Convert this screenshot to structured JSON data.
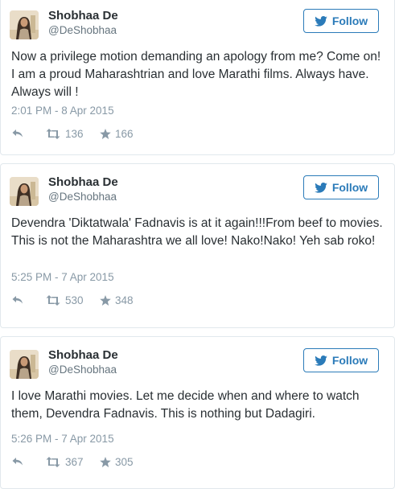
{
  "colors": {
    "follow_accent": "#2b7bb9",
    "meta_gray": "#8899a6",
    "handle_gray": "#66757f",
    "text": "#292f33",
    "border": "#e1e8ed"
  },
  "tweets": [
    {
      "author": {
        "name": "Shobhaa De",
        "handle": "@DeShobhaa"
      },
      "follow_label": "Follow",
      "text": "Now a privilege motion demanding an apology from me? Come on! I am a proud Maharashtrian and love Marathi films. Always have. Always will !",
      "timestamp": "2:01 PM - 8 Apr 2015",
      "retweets": "136",
      "favorites": "166",
      "icons": {
        "follow": "twitter-bird-icon",
        "reply": "reply-icon",
        "retweet": "retweet-icon",
        "favorite": "star-icon"
      }
    },
    {
      "author": {
        "name": "Shobhaa De",
        "handle": "@DeShobhaa"
      },
      "follow_label": "Follow",
      "text": "Devendra 'Diktatwala' Fadnavis is at it again!!!From beef to movies. This is not the Maharashtra we all love! Nako!Nako! Yeh sab roko!",
      "timestamp": "5:25 PM - 7 Apr 2015",
      "retweets": "530",
      "favorites": "348",
      "icons": {
        "follow": "twitter-bird-icon",
        "reply": "reply-icon",
        "retweet": "retweet-icon",
        "favorite": "star-icon"
      }
    },
    {
      "author": {
        "name": "Shobhaa De",
        "handle": "@DeShobhaa"
      },
      "follow_label": "Follow",
      "text": "I love Marathi movies. Let me decide when and where to watch them, Devendra Fadnavis. This is nothing but Dadagiri.",
      "timestamp": "5:26 PM - 7 Apr 2015",
      "retweets": "367",
      "favorites": "305",
      "icons": {
        "follow": "twitter-bird-icon",
        "reply": "reply-icon",
        "retweet": "retweet-icon",
        "favorite": "star-icon"
      }
    }
  ]
}
